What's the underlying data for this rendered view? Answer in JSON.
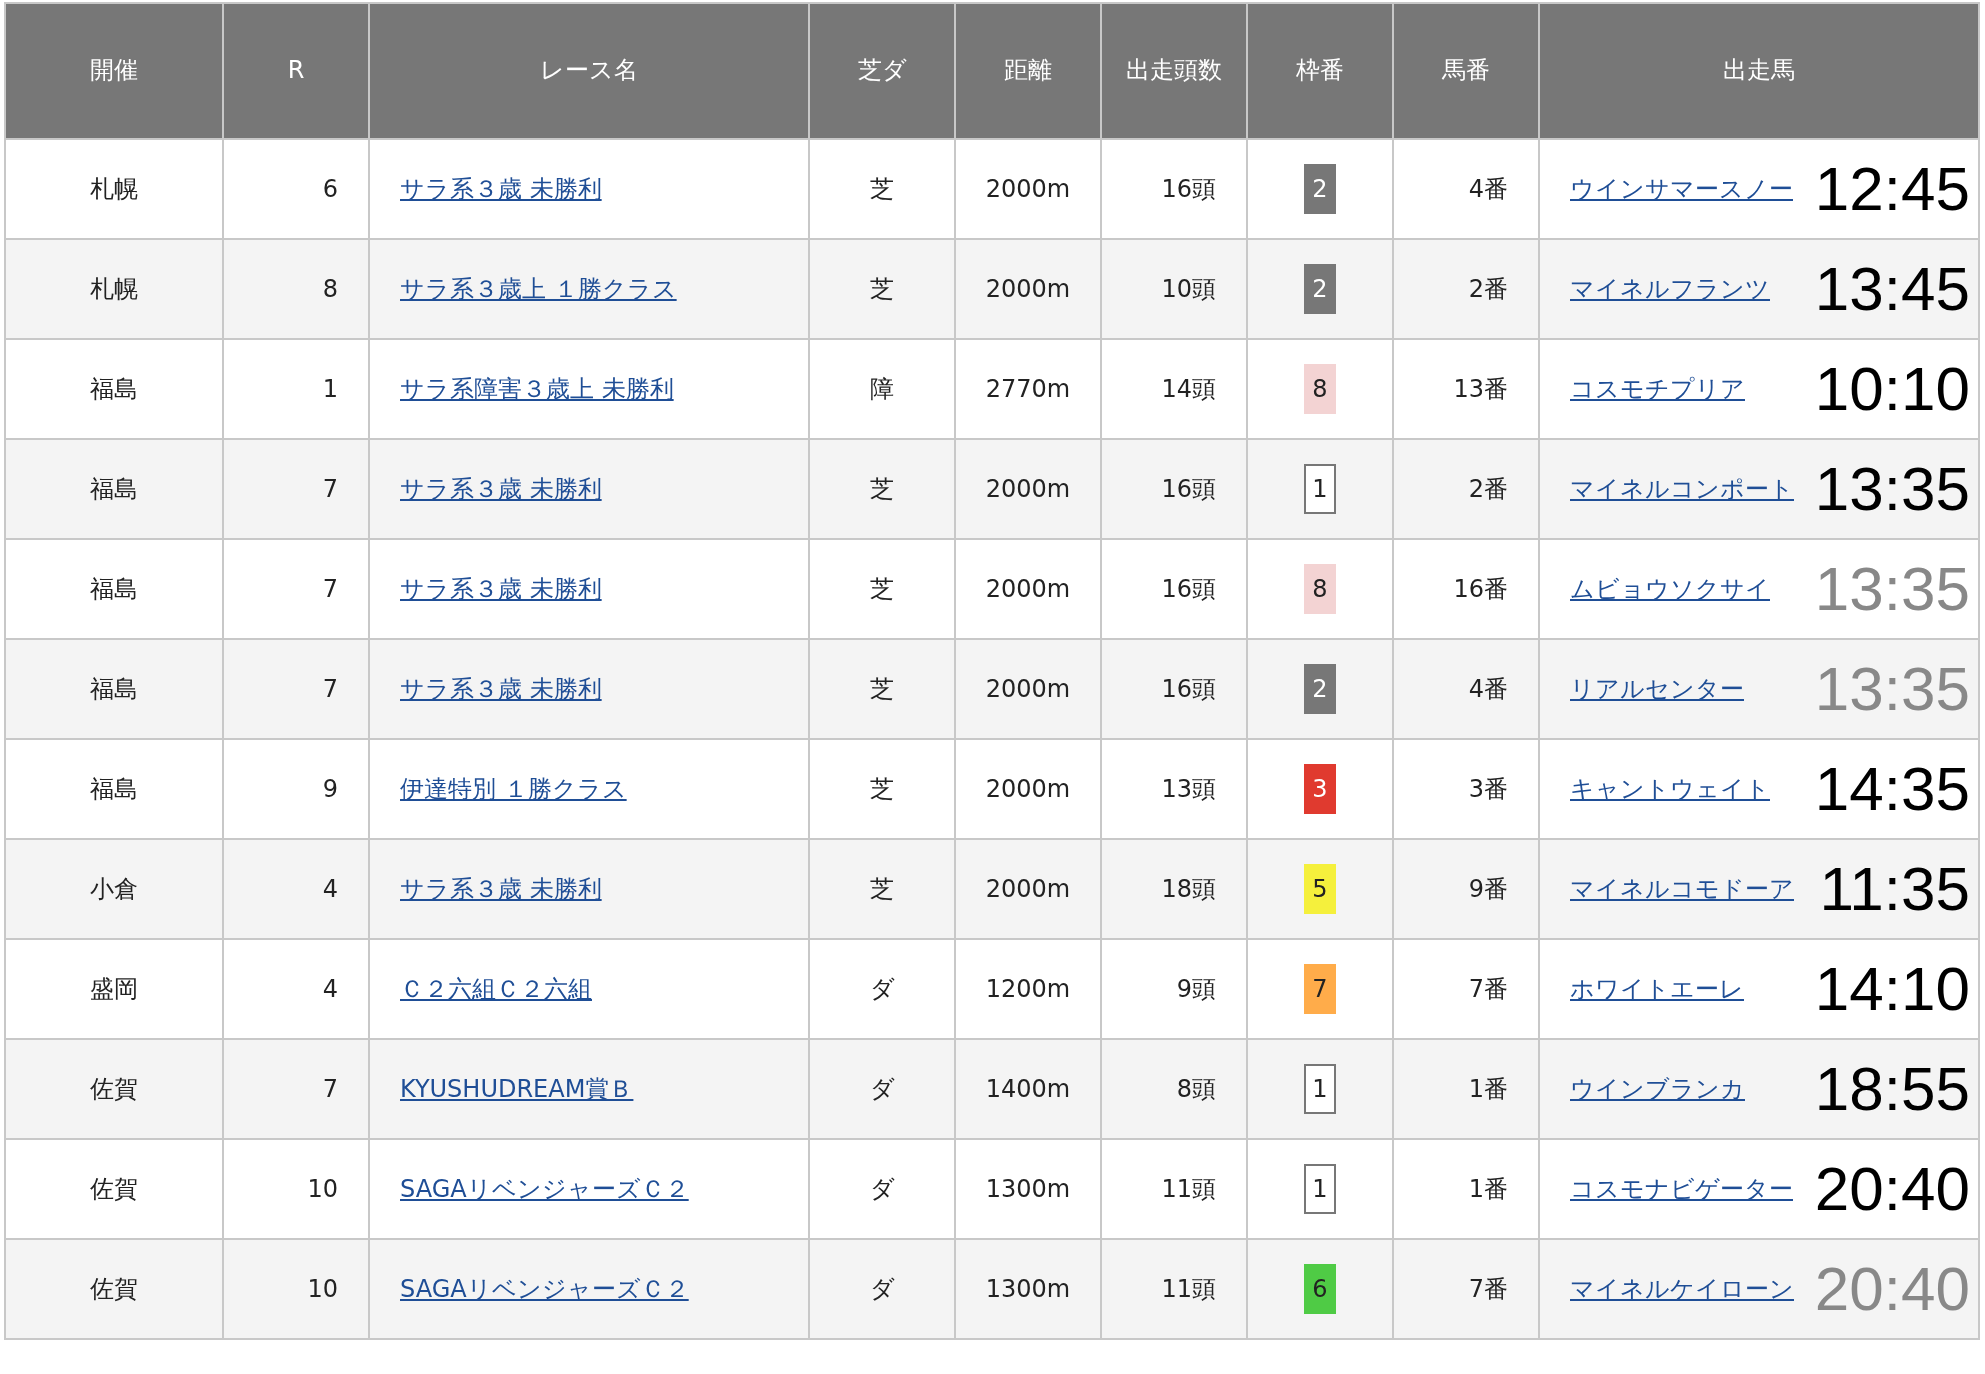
{
  "table": {
    "columns": [
      "開催",
      "R",
      "レース名",
      "芝ダ",
      "距離",
      "出走頭数",
      "枠番",
      "馬番",
      "出走馬"
    ],
    "rows": [
      {
        "venue": "札幌",
        "race_no": "6",
        "race_name": "サラ系３歳 未勝利",
        "surface": "芝",
        "distance": "2000m",
        "runners": "16頭",
        "frame": "2",
        "color": "#777777",
        "horse_no": "4番",
        "horse": "ウインサマースノー",
        "time": "12:45",
        "greyed": false
      },
      {
        "venue": "札幌",
        "race_no": "8",
        "race_name": "サラ系３歳上 １勝クラス",
        "surface": "芝",
        "distance": "2000m",
        "runners": "10頭",
        "frame": "2",
        "color": "#777777",
        "horse_no": "2番",
        "horse": "マイネルフランツ",
        "time": "13:45",
        "greyed": false
      },
      {
        "venue": "福島",
        "race_no": "1",
        "race_name": "サラ系障害３歳上 未勝利",
        "surface": "障",
        "distance": "2770m",
        "runners": "14頭",
        "frame": "8",
        "color": "#f3d3d3",
        "horse_no": "13番",
        "horse": "コスモチプリア",
        "time": "10:10",
        "greyed": false
      },
      {
        "venue": "福島",
        "race_no": "7",
        "race_name": "サラ系３歳 未勝利",
        "surface": "芝",
        "distance": "2000m",
        "runners": "16頭",
        "frame": "1",
        "color": "#ffffff",
        "horse_no": "2番",
        "horse": "マイネルコンポート",
        "time": "13:35",
        "greyed": false
      },
      {
        "venue": "福島",
        "race_no": "7",
        "race_name": "サラ系３歳 未勝利",
        "surface": "芝",
        "distance": "2000m",
        "runners": "16頭",
        "frame": "8",
        "color": "#f3d3d3",
        "horse_no": "16番",
        "horse": "ムビョウソクサイ",
        "time": "13:35",
        "greyed": true
      },
      {
        "venue": "福島",
        "race_no": "7",
        "race_name": "サラ系３歳 未勝利",
        "surface": "芝",
        "distance": "2000m",
        "runners": "16頭",
        "frame": "2",
        "color": "#777777",
        "horse_no": "4番",
        "horse": "リアルセンター",
        "time": "13:35",
        "greyed": true
      },
      {
        "venue": "福島",
        "race_no": "9",
        "race_name": "伊達特別 １勝クラス",
        "surface": "芝",
        "distance": "2000m",
        "runners": "13頭",
        "frame": "3",
        "color": "#e03a2f",
        "horse_no": "3番",
        "horse": "キャントウェイト",
        "time": "14:35",
        "greyed": false
      },
      {
        "venue": "小倉",
        "race_no": "4",
        "race_name": "サラ系３歳 未勝利",
        "surface": "芝",
        "distance": "2000m",
        "runners": "18頭",
        "frame": "5",
        "color": "#f5f03c",
        "horse_no": "9番",
        "horse": "マイネルコモドーア",
        "time": "11:35",
        "greyed": false
      },
      {
        "venue": "盛岡",
        "race_no": "4",
        "race_name": "Ｃ２六組Ｃ２六組",
        "surface": "ダ",
        "distance": "1200m",
        "runners": "9頭",
        "frame": "7",
        "color": "#ffac4a",
        "horse_no": "7番",
        "horse": "ホワイトエーレ",
        "time": "14:10",
        "greyed": false
      },
      {
        "venue": "佐賀",
        "race_no": "7",
        "race_name": "KYUSHUDREAM賞Ｂ",
        "surface": "ダ",
        "distance": "1400m",
        "runners": "8頭",
        "frame": "1",
        "color": "#ffffff",
        "horse_no": "1番",
        "horse": "ウインブランカ",
        "time": "18:55",
        "greyed": false
      },
      {
        "venue": "佐賀",
        "race_no": "10",
        "race_name": "SAGAリベンジャーズＣ２",
        "surface": "ダ",
        "distance": "1300m",
        "runners": "11頭",
        "frame": "1",
        "color": "#ffffff",
        "horse_no": "1番",
        "horse": "コスモナビゲーター",
        "time": "20:40",
        "greyed": false
      },
      {
        "venue": "佐賀",
        "race_no": "10",
        "race_name": "SAGAリベンジャーズＣ２",
        "surface": "ダ",
        "distance": "1300m",
        "runners": "11頭",
        "frame": "6",
        "color": "#4fcb45",
        "horse_no": "7番",
        "horse": "マイネルケイローン",
        "time": "20:40",
        "greyed": true
      }
    ]
  }
}
